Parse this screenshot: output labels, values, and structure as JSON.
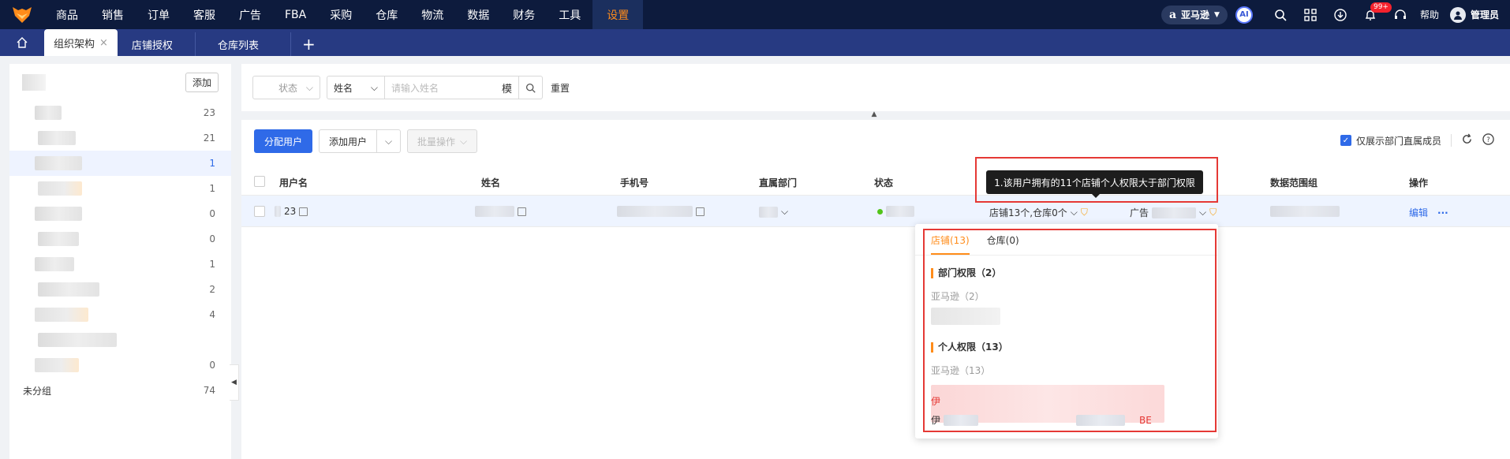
{
  "nav": {
    "items": [
      "商品",
      "销售",
      "订单",
      "客服",
      "广告",
      "FBA",
      "采购",
      "仓库",
      "物流",
      "数据",
      "财务",
      "工具",
      "设置"
    ],
    "active_index": 12,
    "marketplace": "亚马逊",
    "marketplace_logo": "a",
    "ai_label": "AI",
    "notification_count": "99+",
    "help_label": "帮助",
    "user_label": "管理员",
    "accent_color": "#ff8c1a",
    "bg_color": "#0d1b3d"
  },
  "tabs": {
    "items": [
      {
        "label": "组织架构",
        "active": true
      },
      {
        "label": "店铺授权",
        "active": false
      },
      {
        "label": "仓库列表",
        "active": false
      }
    ],
    "close_glyph": "×",
    "add_glyph": "+"
  },
  "left_panel": {
    "add_button": "添加",
    "departments": [
      {
        "count": "23",
        "selected": false
      },
      {
        "count": "21",
        "selected": false
      },
      {
        "count": "1",
        "selected": true
      },
      {
        "count": "1",
        "selected": false
      },
      {
        "count": "0",
        "selected": false
      },
      {
        "count": "0",
        "selected": false
      },
      {
        "count": "1",
        "selected": false
      },
      {
        "count": "2",
        "selected": false
      },
      {
        "count": "4",
        "selected": false
      },
      {
        "count": "",
        "selected": false
      },
      {
        "count": "0",
        "selected": false
      }
    ],
    "ungrouped": {
      "label": "未分组",
      "count": "74"
    }
  },
  "filter": {
    "status_placeholder": "状态",
    "field_select": "姓名",
    "search_placeholder": "请输入姓名",
    "search_mode": "模",
    "reset": "重置"
  },
  "toolbar": {
    "assign_user": "分配用户",
    "add_user": "添加用户",
    "batch_ops": "批量操作",
    "only_direct": "仅展示部门直属成员",
    "only_direct_checked": true
  },
  "table": {
    "headers": [
      "用户名",
      "姓名",
      "手机号",
      "直属部门",
      "状态",
      "数据范围组",
      "操作"
    ],
    "row": {
      "username_suffix": "23",
      "permission_summary": "店铺13个,仓库0个",
      "ad_prefix": "广告",
      "edit": "编辑",
      "more": "···"
    }
  },
  "tooltip": {
    "text": "1.该用户拥有的11个店铺个人权限大于部门权限"
  },
  "popover": {
    "tab_store": "店铺(13)",
    "tab_warehouse": "仓库(0)",
    "dept_perm_title": "部门权限（2）",
    "dept_perm_sub": "亚马逊（2）",
    "personal_perm_title": "个人权限（13）",
    "personal_perm_sub": "亚马逊（13）",
    "red_item_prefix": "伊",
    "last_item_prefix": "伊",
    "last_item_suffix": "BE"
  },
  "colors": {
    "primary": "#2f6ae8",
    "highlight_red": "#e53935",
    "warn": "#f5a623"
  }
}
